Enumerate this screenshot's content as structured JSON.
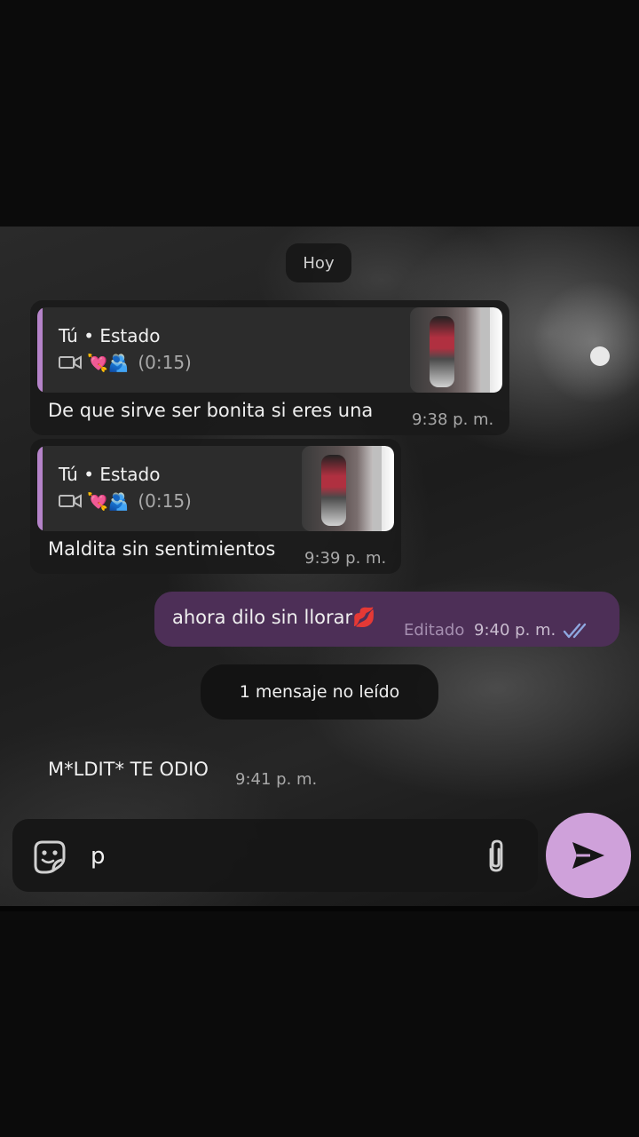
{
  "chat": {
    "date_label": "Hoy",
    "messages": [
      {
        "reply_title": "Tú • Estado",
        "reply_emojis": "💘🫂",
        "reply_duration": "(0:15)",
        "text": "De que sirve ser bonita  si eres una",
        "time": "9:38 p. m."
      },
      {
        "reply_title": "Tú • Estado",
        "reply_emojis": "💘🫂",
        "reply_duration": "(0:15)",
        "text": "Maldita sin sentimientos",
        "time": "9:39 p. m."
      },
      {
        "text": "ahora dilo sin llorar💋",
        "edited_label": "Editado",
        "time": "9:40 p. m."
      }
    ],
    "unread_label": "1 mensaje no leído",
    "last_message": {
      "text": "M*LDIT* TE ODIO",
      "time": "9:41 p. m."
    }
  },
  "composer": {
    "input_value": "p",
    "sticker_icon": "sticker-icon",
    "attach_icon": "paperclip-icon",
    "send_icon": "send-icon"
  },
  "colors": {
    "accent": "#cfa1da",
    "outgoing_bubble": "#4d2f57",
    "reply_bar": "#b583c9",
    "read_ticks": "#8fa8e0"
  }
}
